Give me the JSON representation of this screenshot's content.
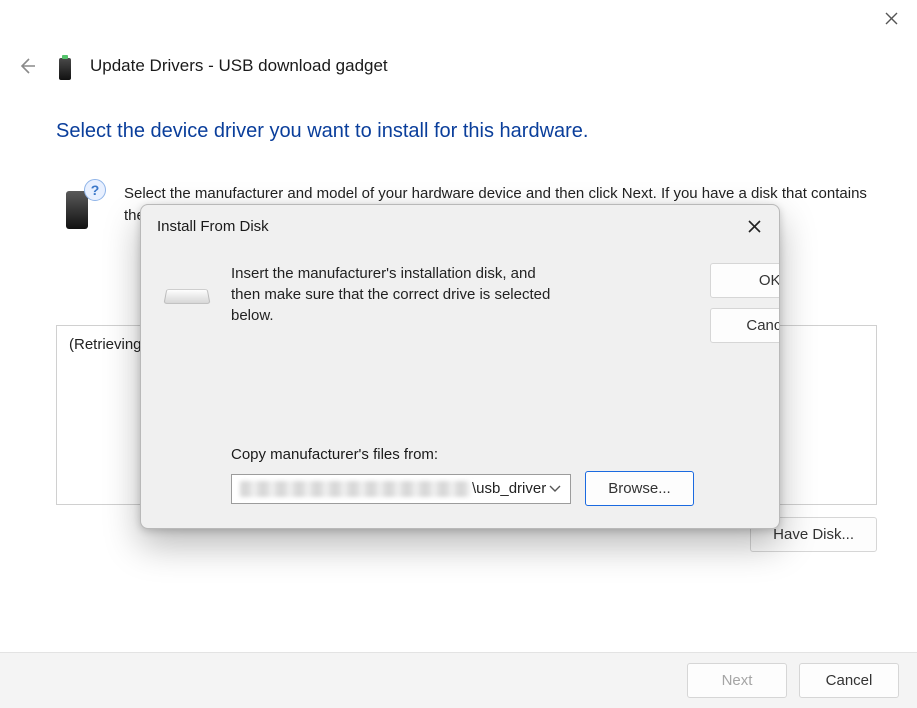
{
  "wizard": {
    "title": "Update Drivers - USB download gadget",
    "heading": "Select the device driver you want to install for this hardware.",
    "instruction": "Select the manufacturer and model of your hardware device and then click Next. If you have a disk that contains the driver you want to install, click Have Disk.",
    "list_status": "(Retrieving",
    "have_disk_label": "Have Disk...",
    "next_label": "Next",
    "cancel_label": "Cancel"
  },
  "modal": {
    "title": "Install From Disk",
    "instruction": "Insert the manufacturer's installation disk, and then make sure that the correct drive is selected below.",
    "ok_label": "OK",
    "cancel_label": "Cancel",
    "copy_from_label": "Copy manufacturer's files from:",
    "path_suffix": "\\usb_driver",
    "browse_label": "Browse..."
  }
}
